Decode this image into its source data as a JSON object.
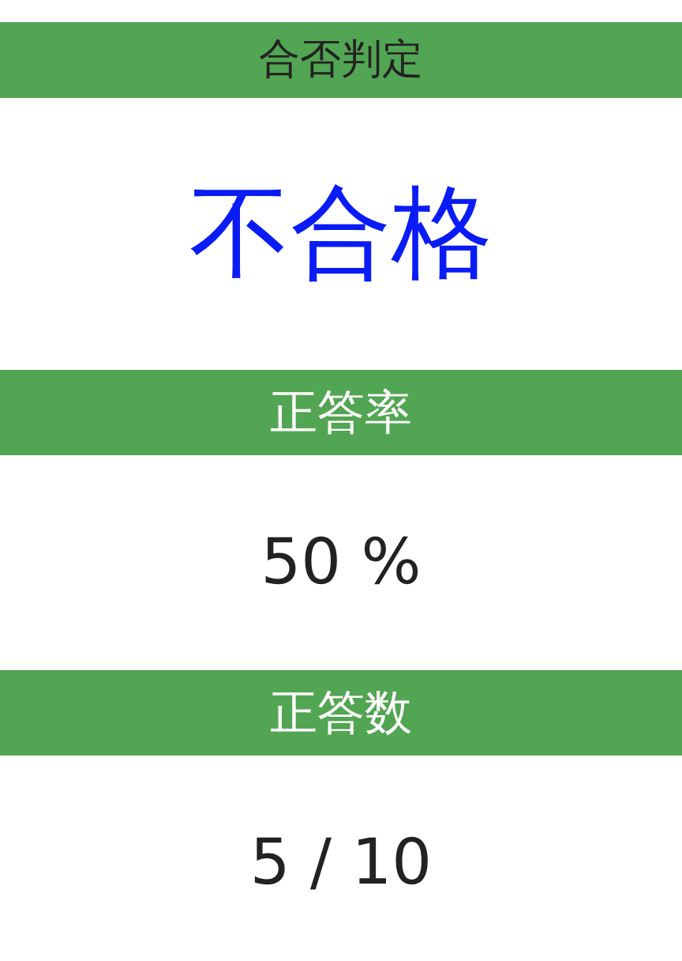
{
  "sections": [
    {
      "kind": "verdict",
      "title": "合否判定",
      "value": "不合格"
    },
    {
      "kind": "stat",
      "title": "正答率",
      "value": "50 %"
    },
    {
      "kind": "stat",
      "title": "正答数",
      "value": "5 / 10"
    }
  ]
}
